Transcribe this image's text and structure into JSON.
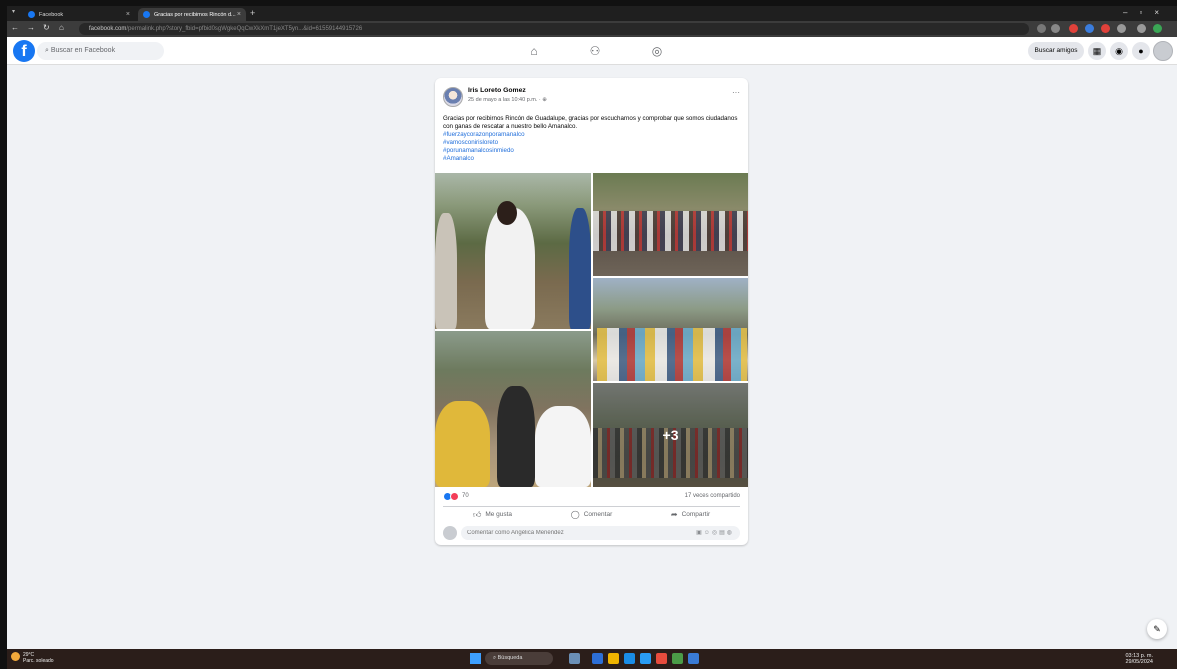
{
  "browser": {
    "tabs": [
      {
        "title": "Facebook"
      },
      {
        "title": "Gracias por recibirnos Rincón d..."
      }
    ],
    "url_host": "facebook.com",
    "url_path": "/permalink.php?story_fbid=pfbid0sgWgkeQqCwXkXmT1jeXT5yn...&id=61559144915726"
  },
  "fb_header": {
    "logo": "f",
    "search_placeholder": "Buscar en Facebook",
    "nav_icons": [
      "home-icon",
      "friends-icon",
      "gaming-icon"
    ],
    "find_friends_label": "Buscar amigos"
  },
  "post": {
    "author": "Iris Loreto Gomez",
    "timestamp": "25 de mayo a las 10:40 p.m. ·",
    "text": "Gracias por recibirnos Rincón de Guadalupe, gracias por escucharnos y comprobar que somos ciudadanos con ganas de rescatar a nuestro bello Amanalco.",
    "hashtags": [
      "#fuerzaycorazonporamanalco",
      "#vamosconirisloreto",
      "#porunamanalcosinmiedo",
      "#Amanalco"
    ],
    "more_photos_label": "+3",
    "reaction_count": "70",
    "shares_label": "17 veces compartido",
    "actions": {
      "like": "Me gusta",
      "comment": "Comentar",
      "share": "Compartir"
    },
    "comment_placeholder": "Comentar como Angélica Menéndez"
  },
  "taskbar": {
    "temperature": "29°C",
    "weather_text": "Parc. soleado",
    "search_label": "Búsqueda",
    "time": "03:13 p. m.",
    "date": "29/05/2024"
  },
  "colors": {
    "brand": "#1877f2",
    "background": "#f0f2f5",
    "hashtag": "#216fdb"
  }
}
